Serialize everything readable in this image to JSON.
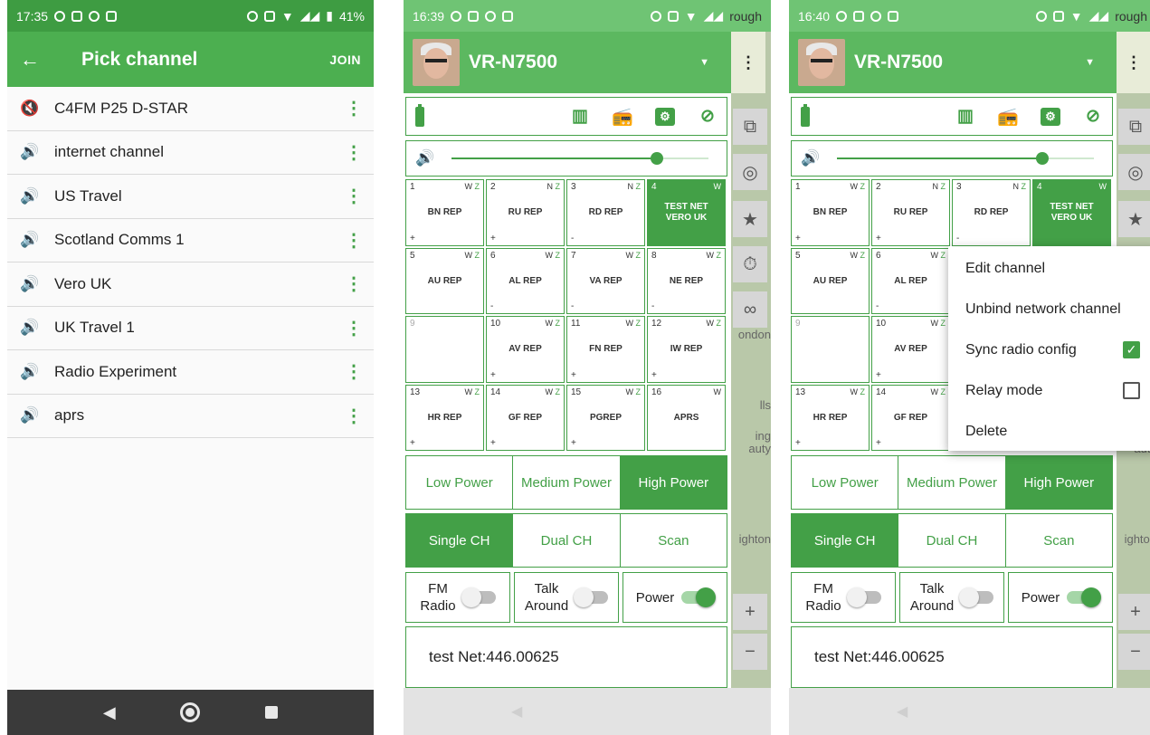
{
  "phone1": {
    "status": {
      "time": "17:35",
      "battery": "41%"
    },
    "appbar": {
      "back": "←",
      "title": "Pick channel",
      "join": "JOIN"
    },
    "channels": [
      {
        "name": "C4FM P25 D-STAR",
        "icon": "speaker-muted-icon"
      },
      {
        "name": "internet channel",
        "icon": "speaker-icon"
      },
      {
        "name": "US Travel",
        "icon": "speaker-icon"
      },
      {
        "name": "Scotland Comms 1",
        "icon": "speaker-icon"
      },
      {
        "name": "Vero UK",
        "icon": "speaker-icon"
      },
      {
        "name": "UK Travel 1",
        "icon": "speaker-icon"
      },
      {
        "name": "Radio Experiment",
        "icon": "speaker-icon"
      },
      {
        "name": "aprs",
        "icon": "speaker-icon"
      }
    ]
  },
  "phone2": {
    "status": {
      "time": "16:39",
      "carrier": "rough"
    },
    "device_name": "VR-N7500",
    "volume_fraction": 0.8,
    "channels": [
      {
        "num": "1",
        "flags": "W",
        "flag2": "Z",
        "name": "BN REP",
        "sign": "+"
      },
      {
        "num": "2",
        "flags": "N",
        "flag2": "Z",
        "name": "RU REP",
        "sign": "+"
      },
      {
        "num": "3",
        "flags": "N",
        "flag2": "Z",
        "name": "RD REP",
        "sign": "-"
      },
      {
        "num": "4",
        "flags": "W",
        "flag2": "",
        "name": "TEST NET",
        "name2": "VERO UK",
        "sign": ""
      },
      {
        "num": "5",
        "flags": "W",
        "flag2": "Z",
        "name": "AU REP",
        "sign": ""
      },
      {
        "num": "6",
        "flags": "W",
        "flag2": "Z",
        "name": "AL REP",
        "sign": "-"
      },
      {
        "num": "7",
        "flags": "W",
        "flag2": "Z",
        "name": "VA REP",
        "sign": "-"
      },
      {
        "num": "8",
        "flags": "W",
        "flag2": "Z",
        "name": "NE REP",
        "sign": "-"
      },
      {
        "num": "9",
        "flags": "",
        "flag2": "",
        "name": "",
        "sign": ""
      },
      {
        "num": "10",
        "flags": "W",
        "flag2": "Z",
        "name": "AV REP",
        "sign": "+"
      },
      {
        "num": "11",
        "flags": "W",
        "flag2": "Z",
        "name": "FN REP",
        "sign": "+"
      },
      {
        "num": "12",
        "flags": "W",
        "flag2": "Z",
        "name": "IW REP",
        "sign": "+"
      },
      {
        "num": "13",
        "flags": "W",
        "flag2": "Z",
        "name": "HR REP",
        "sign": "+"
      },
      {
        "num": "14",
        "flags": "W",
        "flag2": "Z",
        "name": "GF REP",
        "sign": "+"
      },
      {
        "num": "15",
        "flags": "W",
        "flag2": "Z",
        "name": "PGREP",
        "sign": "+"
      },
      {
        "num": "16",
        "flags": "W",
        "flag2": "",
        "name": "APRS",
        "sign": ""
      }
    ],
    "power": {
      "low": "Low Power",
      "medium": "Medium Power",
      "high": "High Power"
    },
    "mode": {
      "single": "Single CH",
      "dual": "Dual CH",
      "scan": "Scan"
    },
    "toggles": {
      "fm_radio_1": "FM",
      "fm_radio_2": "Radio",
      "talk_1": "Talk",
      "talk_2": "Around",
      "power": "Power"
    },
    "net_info": "test Net:446.00625"
  },
  "phone3": {
    "status": {
      "time": "16:40",
      "carrier": "rough"
    },
    "menu": {
      "edit": "Edit channel",
      "unbind": "Unbind network channel",
      "sync": "Sync radio config",
      "relay": "Relay mode",
      "delete": "Delete",
      "sync_checked": true,
      "relay_checked": false
    },
    "map_labels": {
      "a": "ondon",
      "b": "lls",
      "c": "ing",
      "d": "auty",
      "e": "ighton"
    }
  },
  "colors": {
    "primary": "#4caf50",
    "accent": "#43a047",
    "dark_nav": "#3a3a3a"
  }
}
